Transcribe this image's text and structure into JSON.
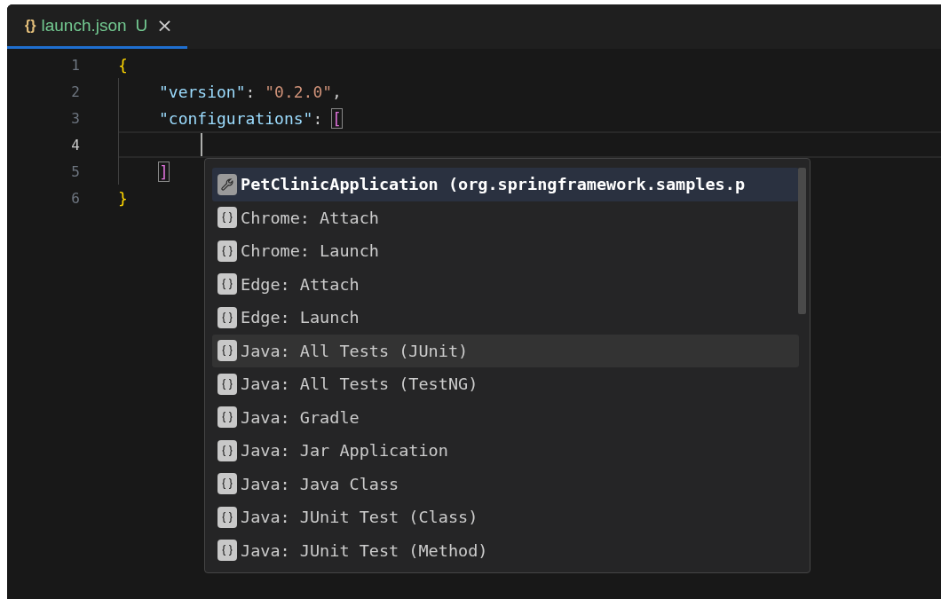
{
  "tabs": [
    {
      "icon": "{}",
      "label": "launch.json",
      "badge": "U",
      "close": "×",
      "selected": true
    }
  ],
  "editor": {
    "lines": [
      {
        "number": "1",
        "current": false,
        "cursor": false,
        "tokens": [
          {
            "text": "{",
            "kind": "brace"
          }
        ]
      },
      {
        "number": "2",
        "current": false,
        "cursor": false,
        "tokens": [
          {
            "text": "\"version\"",
            "kind": "key"
          },
          {
            "text": ": ",
            "kind": "punct"
          },
          {
            "text": "\"0.2.0\"",
            "kind": "string"
          },
          {
            "text": ",",
            "kind": "punct"
          }
        ]
      },
      {
        "number": "3",
        "current": false,
        "cursor": false,
        "tokens": [
          {
            "text": "\"configurations\"",
            "kind": "key"
          },
          {
            "text": ": ",
            "kind": "punct"
          },
          {
            "text": "[",
            "kind": "bracket"
          }
        ]
      },
      {
        "number": "4",
        "current": true,
        "cursor": true
      },
      {
        "number": "5",
        "current": false,
        "cursor": false,
        "tokens": [
          {
            "text": "]",
            "kind": "bracket"
          }
        ]
      },
      {
        "number": "6",
        "current": false,
        "cursor": false,
        "tokens": [
          {
            "text": "}",
            "kind": "brace"
          }
        ]
      }
    ]
  },
  "suggestions": [
    {
      "label": "PetClinicApplication (org.springframework.samples.p",
      "kind": "property",
      "selected": true,
      "hovered": false
    },
    {
      "label": "Chrome: Attach",
      "kind": "snippet",
      "selected": false,
      "hovered": false
    },
    {
      "label": "Chrome: Launch",
      "kind": "snippet",
      "selected": false,
      "hovered": false
    },
    {
      "label": "Edge: Attach",
      "kind": "snippet",
      "selected": false,
      "hovered": false
    },
    {
      "label": "Edge: Launch",
      "kind": "snippet",
      "selected": false,
      "hovered": false
    },
    {
      "label": "Java: All Tests (JUnit)",
      "kind": "snippet",
      "selected": false,
      "hovered": true
    },
    {
      "label": "Java: All Tests (TestNG)",
      "kind": "snippet",
      "selected": false,
      "hovered": false
    },
    {
      "label": "Java: Gradle",
      "kind": "snippet",
      "selected": false,
      "hovered": false
    },
    {
      "label": "Java: Jar Application",
      "kind": "snippet",
      "selected": false,
      "hovered": false
    },
    {
      "label": "Java: Java Class",
      "kind": "snippet",
      "selected": false,
      "hovered": false
    },
    {
      "label": "Java: JUnit Test (Class)",
      "kind": "snippet",
      "selected": false,
      "hovered": false
    },
    {
      "label": "Java: JUnit Test (Method)",
      "kind": "snippet",
      "selected": false,
      "hovered": false
    }
  ]
}
